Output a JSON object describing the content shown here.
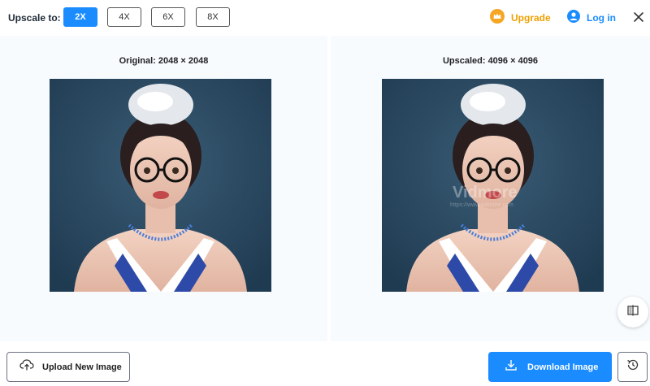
{
  "toolbar": {
    "upscale_label": "Upscale to:",
    "scales": [
      "2X",
      "4X",
      "6X",
      "8X"
    ],
    "active_scale": "2X",
    "upgrade_label": "Upgrade",
    "login_label": "Log in"
  },
  "panels": {
    "original_caption": "Original: 2048 × 2048",
    "upscaled_caption": "Upscaled: 4096 × 4096"
  },
  "watermark": {
    "brand": "Vidmore",
    "url": "https://www.vidmore.com"
  },
  "bottom": {
    "upload_label": "Upload New Image",
    "download_label": "Download Image"
  },
  "colors": {
    "accent": "#1a8cff",
    "upgrade": "#f0a000",
    "image_bg": "#2a4a63"
  },
  "icons": [
    "crown-icon",
    "user-icon",
    "close-icon",
    "compare-icon",
    "cloud-upload-icon",
    "download-icon",
    "history-icon"
  ]
}
